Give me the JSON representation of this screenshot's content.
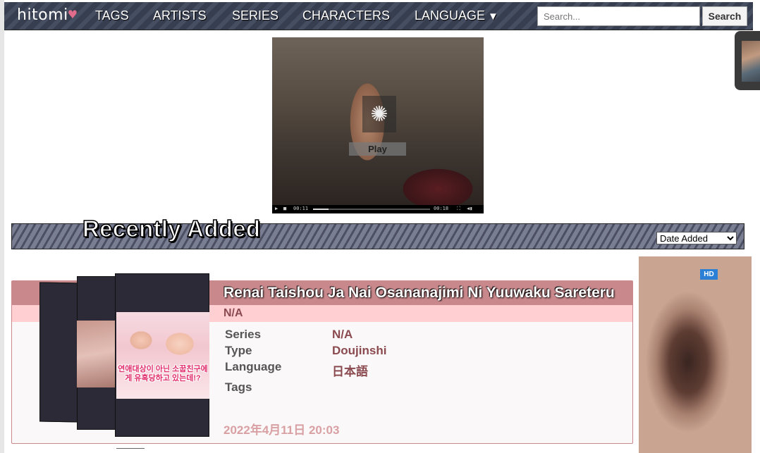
{
  "nav": {
    "logo": "hitomi",
    "links": [
      "TAGS",
      "ARTISTS",
      "SERIES",
      "CHARACTERS",
      "LANGUAGE"
    ],
    "language_caret": "▼",
    "search_placeholder": "Search...",
    "search_button": "Search"
  },
  "player": {
    "play_label": "Play",
    "time_current": "00:11",
    "time_total": "00:18",
    "progress": 0.13
  },
  "recent": {
    "title": "Recently Added",
    "sort_selected": "Date Added"
  },
  "gallery": {
    "title": "Renai Taishou Ja Nai Osananajimi Ni Yuuwaku Sareteru",
    "artist": "N/A",
    "meta": [
      {
        "label": "Series",
        "value": "N/A"
      },
      {
        "label": "Type",
        "value": "Doujinshi"
      },
      {
        "label": "Language",
        "value": "日本語"
      },
      {
        "label": "Tags",
        "value": ""
      }
    ],
    "date": "2022年4月11日 20:03",
    "cover_text": "연애대상이 아닌 소꿉친구에게 유혹당하고 있는데!?"
  },
  "ad": {
    "badge": "HD"
  },
  "colors": {
    "nav_bg": "#3b4357",
    "card_header": "#c9888c",
    "card_sub": "#ffcfd2",
    "meta_value": "#8a4a4f",
    "date": "#d9a0a4"
  }
}
